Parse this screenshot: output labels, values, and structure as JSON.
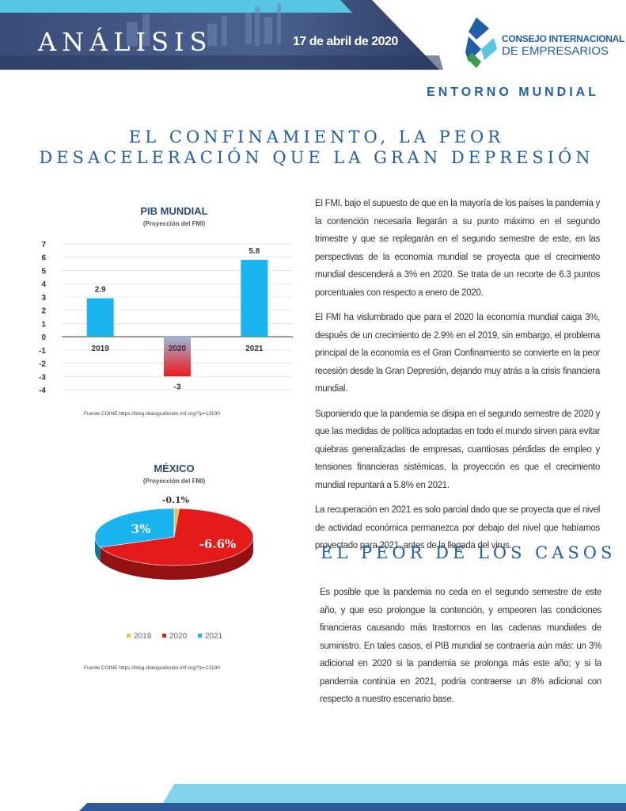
{
  "header": {
    "section": "ANÁLISIS",
    "date": "17 de abril de 2020",
    "logo_line1": "CONSEJO INTERNACIONAL",
    "logo_line2": "DE EMPRESARIOS"
  },
  "section_tag": "ENTORNO MUNDIAL",
  "title_line1": "EL CONFINAMIENTO, LA PEOR",
  "title_line2": "DESACELERACIÓN QUE LA GRAN DEPRESIÓN",
  "paragraphs": [
    "El FMI, bajo el supuesto de que en la mayoría de los países la pandemia y la contención necesaria llegarán a su punto máximo en el segundo trimestre y que se replegarán en el segundo semestre de este, en las perspectivas de la economía mundial se proyecta que el crecimiento mundial descenderá a 3% en 2020. Se trata de un recorte de 6.3 puntos porcentuales con respecto a enero de 2020.",
    "El FMI ha vislumbrado que para el 2020 la economía mundial caiga 3%, después de un crecimiento de 2.9% en el 2019, sin embargo, el problema principal de la economía es el Gran Confinamiento se convierte en la peor recesión desde la Gran Depresión, dejando muy atrás a la crisis financiera mundial.",
    "Suponiendo que la pandemia se disipa en el segundo semestre de 2020 y que las medidas de política adoptadas en todo el mundo sirven para evitar quiebras generalizadas de empresas, cuantiosas pérdidas de empleo y tensiones financieras sistémicas, la proyección es que el crecimiento mundial repuntará a 5.8% en 2021.",
    "La recuperación en 2021 es solo parcial dado que se proyecta que el nivel de actividad económica permanezca por debajo del nivel que habíamos proyectado para 2021, antes de la llegada del virus."
  ],
  "subtitle": "EL PEOR DE LOS CASOS",
  "paragraph_worst": "Es posible que la pandemia no ceda en el segundo semestre de este año, y que eso prolongue la contención, y empeoren las condiciones financieras causando más trastornos en las cadenas mundiales de suministro. En tales casos, el PIB mundial se contraería aún más: un 3% adicional en 2020 si la pandemia se prolonga más este año; y si la pandemia continúa en 2021, podría contraerse un 8% adicional con respecto a nuestro escenario base.",
  "chart_data": [
    {
      "type": "bar",
      "title": "PIB MUNDIAL",
      "subtitle": "(Proyección del FMI)",
      "categories": [
        "2019",
        "2020",
        "2021"
      ],
      "values": [
        2.9,
        -3,
        5.8
      ],
      "value_labels": [
        "2.9",
        "-3",
        "5.8"
      ],
      "ylim": [
        -4,
        7
      ],
      "yticks": [
        "7",
        "6",
        "5",
        "4",
        "3",
        "2",
        "1",
        "0",
        "-1",
        "-2",
        "-3",
        "-4"
      ],
      "grid": true,
      "colors": [
        "#1ab4ef",
        "#d93a4a",
        "#1ab4ef"
      ],
      "source": "Fuente COINE:https://blog-dialogoafondo.imf.org/?p=13190"
    },
    {
      "type": "pie",
      "title": "MÉXICO",
      "subtitle": "(Proyección del FMI)",
      "categories": [
        "2019",
        "2020",
        "2021"
      ],
      "values": [
        -0.1,
        -6.6,
        3
      ],
      "value_labels": [
        "-0.1%",
        "-6.6%",
        "3%"
      ],
      "colors": [
        "#e8c23a",
        "#e51a1a",
        "#1ab4ef"
      ],
      "legend": "bottom",
      "source": "Fuente COINE:https://blog-dialogoafondo.imf.org/?p=13190"
    }
  ]
}
